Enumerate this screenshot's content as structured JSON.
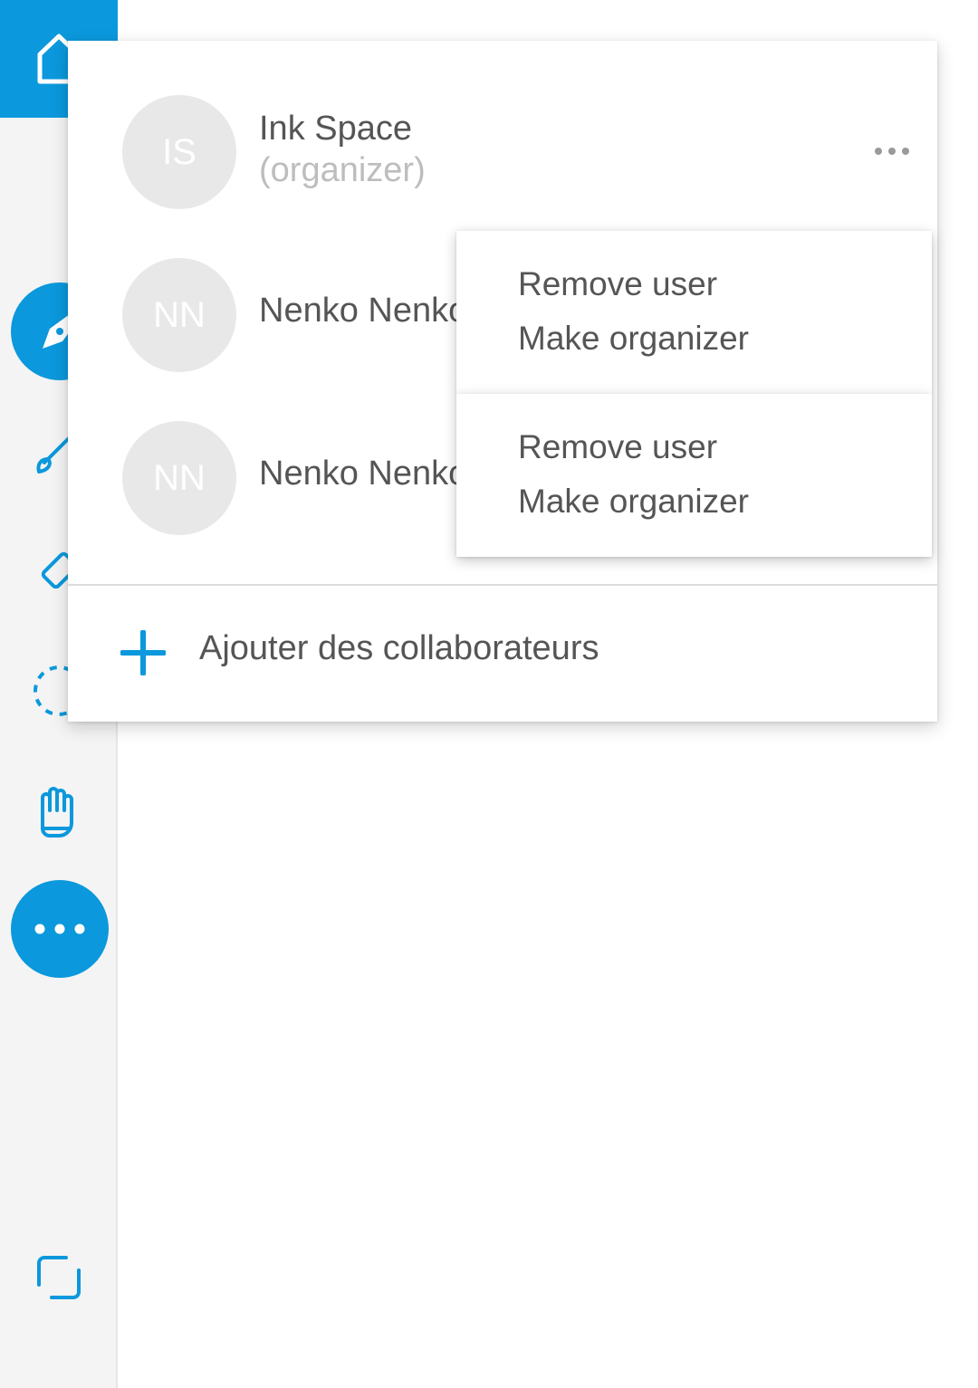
{
  "sidebar": {
    "icons": [
      "home-icon",
      "pen-icon",
      "brush-icon",
      "eraser-icon",
      "lasso-select-icon",
      "hand-pan-icon",
      "more-icon",
      "resize-icon"
    ]
  },
  "members": [
    {
      "initials": "IS",
      "name": "Ink Space",
      "role": "(organizer)"
    },
    {
      "initials": "NN",
      "name": "Nenko Nenkov"
    },
    {
      "initials": "NN",
      "name": "Nenko Nenkov"
    }
  ],
  "context_menus": [
    {
      "remove_label": "Remove user",
      "organizer_label": "Make organizer"
    },
    {
      "remove_label": "Remove user",
      "organizer_label": "Make organizer"
    }
  ],
  "add_collaborators_label": "Ajouter des collaborateurs",
  "colors": {
    "accent": "#0b98dc",
    "sidebar_bg": "#f4f4f4",
    "text": "#555555",
    "muted_text": "#bdbdbd",
    "avatar_bg": "#e8e8e8"
  }
}
